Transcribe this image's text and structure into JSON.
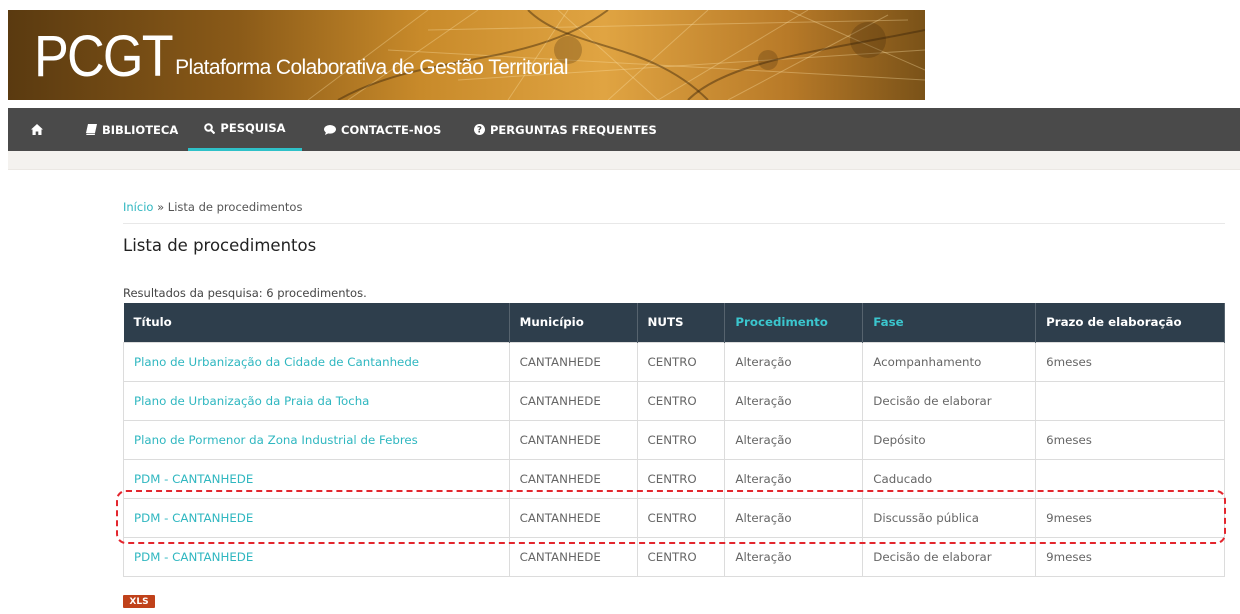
{
  "banner": {
    "logo_big": "PCGT",
    "logo_small": "Plataforma Colaborativa de Gestão Territorial"
  },
  "nav": {
    "home_icon": "home-icon",
    "items": [
      {
        "label": "BIBLIOTECA",
        "icon": "book-icon"
      },
      {
        "label": "PESQUISA",
        "icon": "search-icon",
        "active": true
      },
      {
        "label": "CONTACTE-NOS",
        "icon": "comment-icon"
      },
      {
        "label": "PERGUNTAS FREQUENTES",
        "icon": "question-circle-icon"
      }
    ]
  },
  "breadcrumb": {
    "home": "Início",
    "separator": " » ",
    "current": "Lista de procedimentos"
  },
  "page_title": "Lista de procedimentos",
  "results_text": "Resultados da pesquisa: 6 procedimentos.",
  "table": {
    "headers": [
      "Título",
      "Município",
      "NUTS",
      "Procedimento",
      "Fase",
      "Prazo de elaboração"
    ],
    "rows": [
      [
        "Plano de Urbanização da Cidade de Cantanhede",
        "CANTANHEDE",
        "CENTRO",
        "Alteração",
        "Acompanhamento",
        "6meses"
      ],
      [
        "Plano de Urbanização da Praia da Tocha",
        "CANTANHEDE",
        "CENTRO",
        "Alteração",
        "Decisão de elaborar",
        ""
      ],
      [
        "Plano de Pormenor da Zona Industrial de Febres",
        "CANTANHEDE",
        "CENTRO",
        "Alteração",
        "Depósito",
        "6meses"
      ],
      [
        "PDM - CANTANHEDE",
        "CANTANHEDE",
        "CENTRO",
        "Alteração",
        "Caducado",
        ""
      ],
      [
        "PDM - CANTANHEDE",
        "CANTANHEDE",
        "CENTRO",
        "Alteração",
        "Discussão pública",
        "9meses"
      ],
      [
        "PDM - CANTANHEDE",
        "CANTANHEDE",
        "CENTRO",
        "Alteração",
        "Decisão de elaborar",
        "9meses"
      ]
    ]
  },
  "export_button": "XLS",
  "colors": {
    "accent": "#2fb7c0",
    "nav_bg": "#4a4a4a",
    "table_header_bg": "#2e3e4c",
    "highlight": "#e3262e",
    "xls_bg": "#c0411a"
  }
}
